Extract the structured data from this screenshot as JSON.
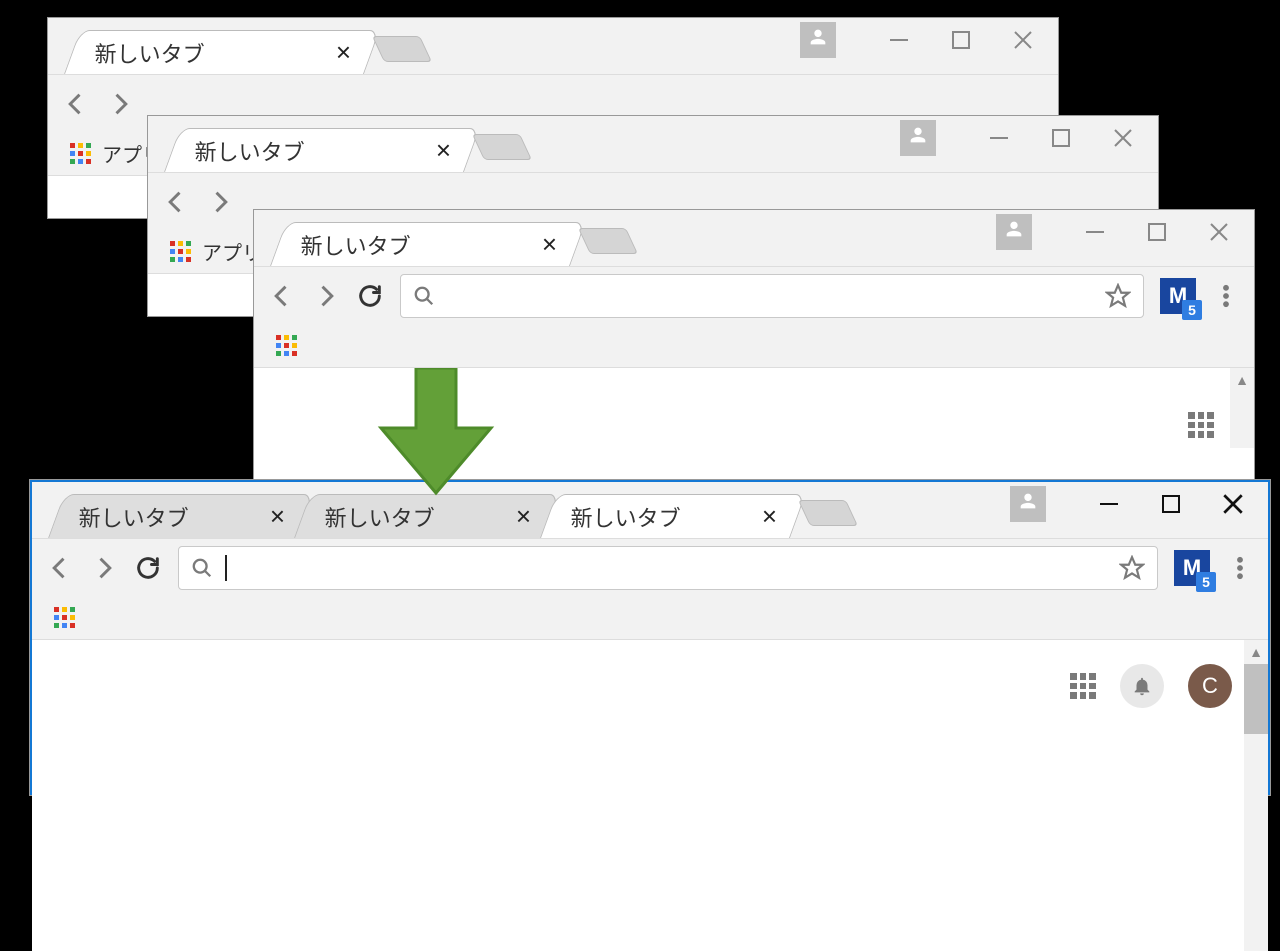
{
  "tab_label": "新しいタブ",
  "apps_label": "アプリ",
  "ext_letter": "M",
  "ext_badge": "5",
  "avatar_letter": "C",
  "windows": {
    "a": {
      "tabs": [
        "新しいタブ"
      ]
    },
    "b": {
      "tabs": [
        "新しいタブ"
      ]
    },
    "c": {
      "tabs": [
        "新しいタブ"
      ]
    },
    "merged": {
      "tabs": [
        "新しいタブ",
        "新しいタブ",
        "新しいタブ"
      ]
    }
  }
}
